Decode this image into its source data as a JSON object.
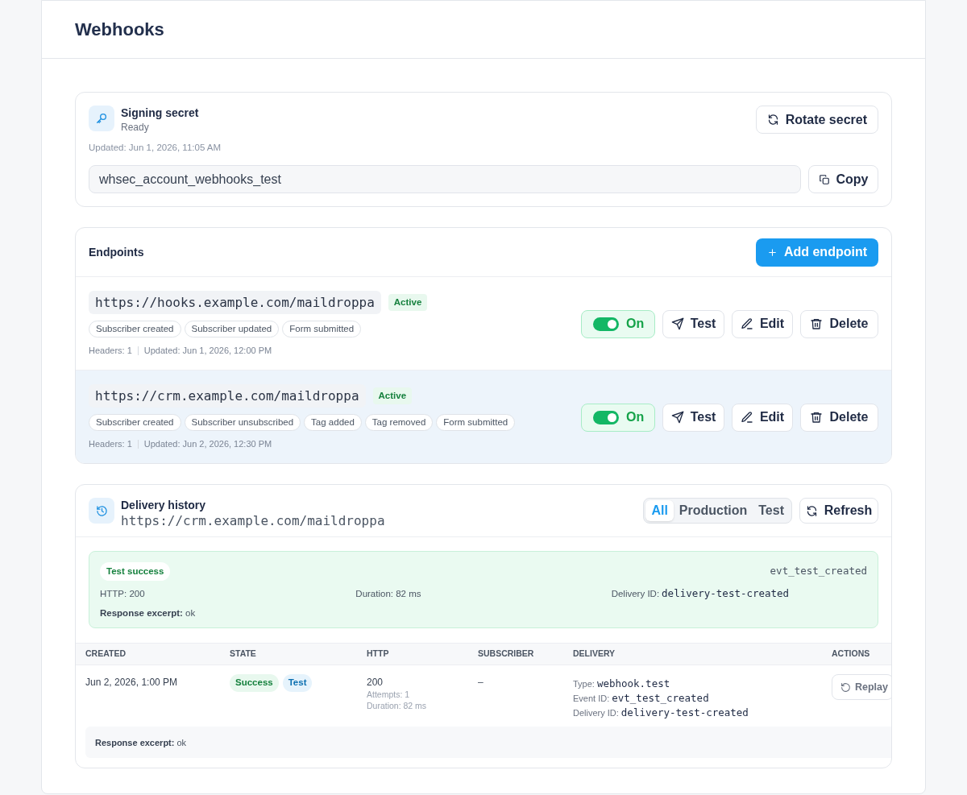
{
  "page": {
    "title": "Webhooks"
  },
  "signing_secret": {
    "title": "Signing secret",
    "status": "Ready",
    "updated": "Updated: Jun 1, 2026, 11:05 AM",
    "secret": "whsec_account_webhooks_test",
    "rotate_button": "Rotate secret",
    "copy_button": "Copy"
  },
  "endpoints": {
    "title": "Endpoints",
    "add_button": "Add endpoint",
    "items": [
      {
        "url": "https://hooks.example.com/maildroppa",
        "status": "Active",
        "events": [
          "Subscriber created",
          "Subscriber updated",
          "Form submitted"
        ],
        "headers": "Headers: 1",
        "updated": "Updated: Jun 1, 2026, 12:00 PM",
        "on": true,
        "toggle_label": "On",
        "selected": false,
        "buttons": [
          {
            "kind": "test",
            "label": "Test"
          },
          {
            "kind": "edit",
            "label": "Edit"
          },
          {
            "kind": "delete",
            "label": "Delete"
          }
        ]
      },
      {
        "url": "https://crm.example.com/maildroppa",
        "status": "Active",
        "events": [
          "Subscriber created",
          "Subscriber unsubscribed",
          "Tag added",
          "Tag removed",
          "Form submitted"
        ],
        "headers": "Headers: 1",
        "updated": "Updated: Jun 2, 2026, 12:30 PM",
        "on": true,
        "toggle_label": "On",
        "selected": true,
        "buttons": [
          {
            "kind": "test",
            "label": "Test"
          },
          {
            "kind": "edit",
            "label": "Edit"
          },
          {
            "kind": "delete",
            "label": "Delete"
          }
        ]
      }
    ]
  },
  "delivery_history": {
    "title": "Delivery history",
    "endpoint_url": "https://crm.example.com/maildroppa",
    "filters": [
      {
        "label": "All",
        "selected": true
      },
      {
        "label": "Production",
        "selected": false
      },
      {
        "label": "Test",
        "selected": false
      }
    ],
    "refresh_button": "Refresh",
    "latest": {
      "badge": "Test success",
      "event_id": "evt_test_created",
      "http": "HTTP: 200",
      "duration": "Duration: 82 ms",
      "delivery_label": "Delivery ID:",
      "delivery_id": "delivery-test-created",
      "excerpt": "**Response excerpt:** ok"
    },
    "table": {
      "columns": [
        "CREATED",
        "STATE",
        "HTTP",
        "SUBSCRIBER",
        "DELIVERY",
        "ACTIONS"
      ],
      "rows": [
        {
          "created": "Jun 2, 2026, 1:00 PM",
          "state": [
            {
              "label": "Success",
              "kind": "success"
            },
            {
              "label": "Test",
              "kind": "test"
            }
          ],
          "http": "200",
          "attempts": "Attempts: 1",
          "duration": "Duration: 82 ms",
          "subscriber": "–",
          "delivery": [
            {
              "label": "Type:",
              "value": "webhook.test"
            },
            {
              "label": "Event ID:",
              "value": "evt_test_created"
            },
            {
              "label": "Delivery ID:",
              "value": "delivery-test-created"
            }
          ],
          "action": "Replay",
          "excerpt": "**Response excerpt:** ok"
        }
      ]
    }
  }
}
